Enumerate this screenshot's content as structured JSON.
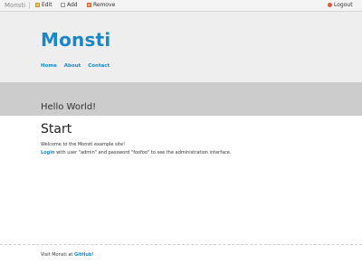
{
  "toolbar": {
    "brand": "Monsti",
    "edit_label": "Edit",
    "add_label": "Add",
    "remove_label": "Remove",
    "logout_label": "Logout"
  },
  "header": {
    "site_title": "Monsti",
    "nav": [
      "Home",
      "About",
      "Contact"
    ]
  },
  "banner": {
    "title": "Hello World!"
  },
  "content": {
    "heading": "Start",
    "welcome": "Welcome to the Monsti example site!",
    "login_link": "Login",
    "login_rest": " with user \"admin\" and password \"foofoo\" to see the administration interface."
  },
  "footer": {
    "prefix": "Visit Monsti at ",
    "link": "GitHub",
    "suffix": "!"
  },
  "colors": {
    "accent": "#1a87c9",
    "header_bg": "#eeeeee",
    "banner_bg": "#cccccc"
  }
}
